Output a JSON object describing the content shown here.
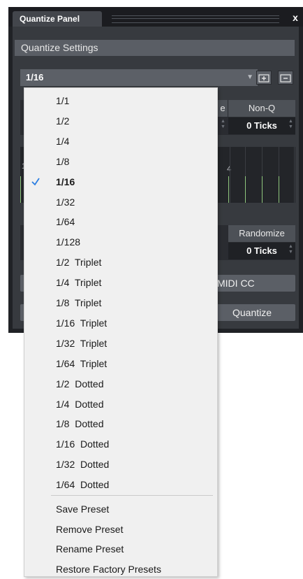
{
  "panel": {
    "tab_label": "Quantize Panel",
    "close_label": "x",
    "section_title": "Quantize Settings",
    "preset_value": "1/16",
    "swing_header_fragment": "e",
    "nonq": {
      "label": "Non-Q",
      "value": "0 Ticks"
    },
    "randomize": {
      "label": "Randomize",
      "value": "0 Ticks"
    },
    "grid_numbers": [
      "1",
      "4"
    ],
    "midi_cc_label": "MIDI CC",
    "quantize_label": "Quantize",
    "colors": {
      "panel_bg": "#373a3f",
      "accent_check": "#2a7de1",
      "grid_note": "#8fc77d"
    }
  },
  "menu": {
    "selected": "1/16",
    "items": [
      "1/1",
      "1/2",
      "1/4",
      "1/8",
      "1/16",
      "1/32",
      "1/64",
      "1/128",
      "1/2  Triplet",
      "1/4  Triplet",
      "1/8  Triplet",
      "1/16  Triplet",
      "1/32  Triplet",
      "1/64  Triplet",
      "1/2  Dotted",
      "1/4  Dotted",
      "1/8  Dotted",
      "1/16  Dotted",
      "1/32  Dotted",
      "1/64  Dotted"
    ],
    "actions": [
      "Save Preset",
      "Remove Preset",
      "Rename Preset",
      "Restore Factory Presets"
    ]
  }
}
